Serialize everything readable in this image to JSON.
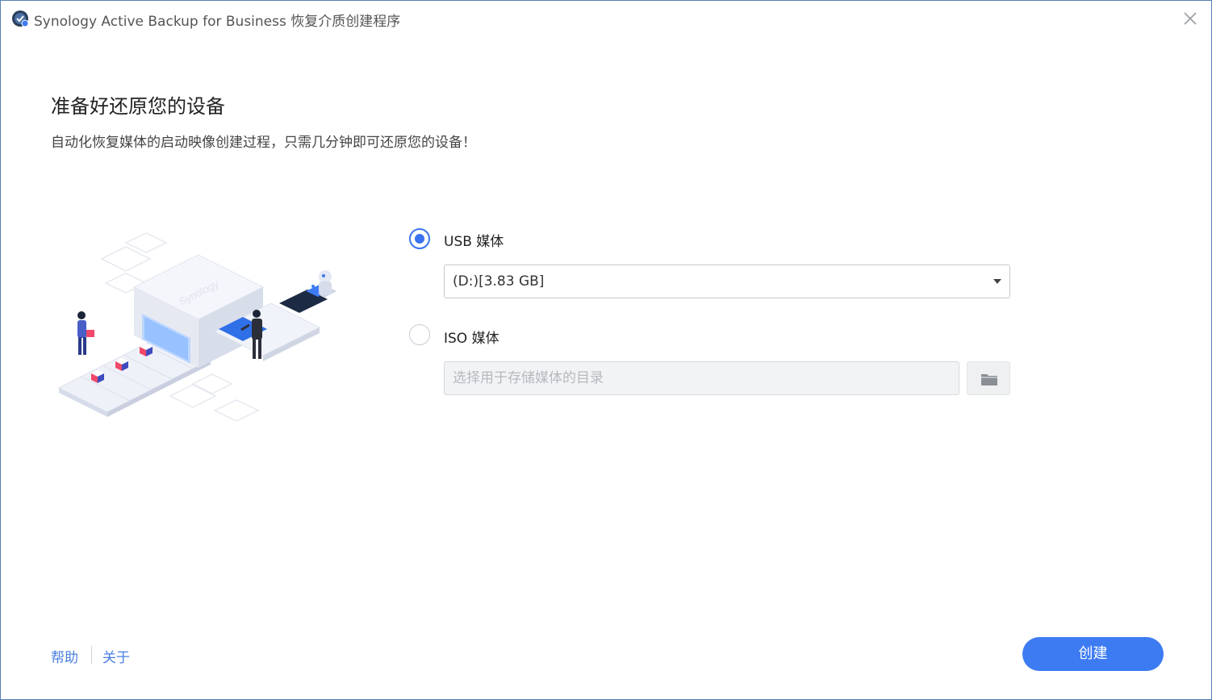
{
  "window": {
    "title": "Synology Active Backup for Business 恢复介质创建程序"
  },
  "main": {
    "heading": "准备好还原您的设备",
    "description": "自动化恢复媒体的启动映像创建过程，只需几分钟即可还原您的设备！"
  },
  "illustration": {
    "brand_text": "Synology"
  },
  "options": {
    "usb": {
      "label": "USB 媒体",
      "selected": true,
      "drive_value": "(D:)[3.83 GB]"
    },
    "iso": {
      "label": "ISO 媒体",
      "selected": false,
      "path_value": "",
      "path_placeholder": "选择用于存储媒体的目录"
    }
  },
  "footer": {
    "help_label": "帮助",
    "about_label": "关于",
    "create_label": "创建"
  },
  "colors": {
    "accent": "#3d7bf2",
    "link": "#4a7fe0",
    "border": "#5a7fb5"
  },
  "icons": {
    "app": "synology-abb-app-icon",
    "close": "close-icon",
    "dropdown": "caret-down-icon",
    "browse": "folder-icon"
  }
}
